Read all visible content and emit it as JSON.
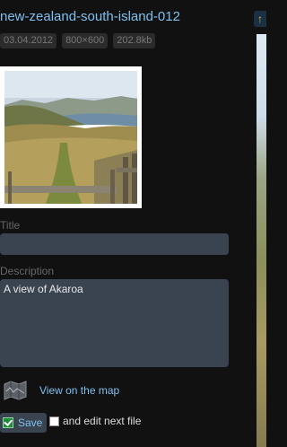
{
  "file": {
    "name": "new-zealand-south-island-012",
    "date": "03.04.2012",
    "dimensions": "800×600",
    "size": "202.8kb"
  },
  "form": {
    "title_label": "Title",
    "title_value": "",
    "description_label": "Description",
    "description_value": "A view of Akaroa"
  },
  "map": {
    "icon": "map-icon",
    "link_label": "View on the map"
  },
  "actions": {
    "save_label": "Save",
    "save_icon": "checkbox-checked-icon",
    "edit_next_label": "and edit next file",
    "edit_next_checked": false
  },
  "side": {
    "button_icon": "arrow-up-icon",
    "button_glyph": "↑"
  },
  "colors": {
    "accent": "#7ec0f0",
    "background": "#111111",
    "input_bg": "#3a4350"
  }
}
